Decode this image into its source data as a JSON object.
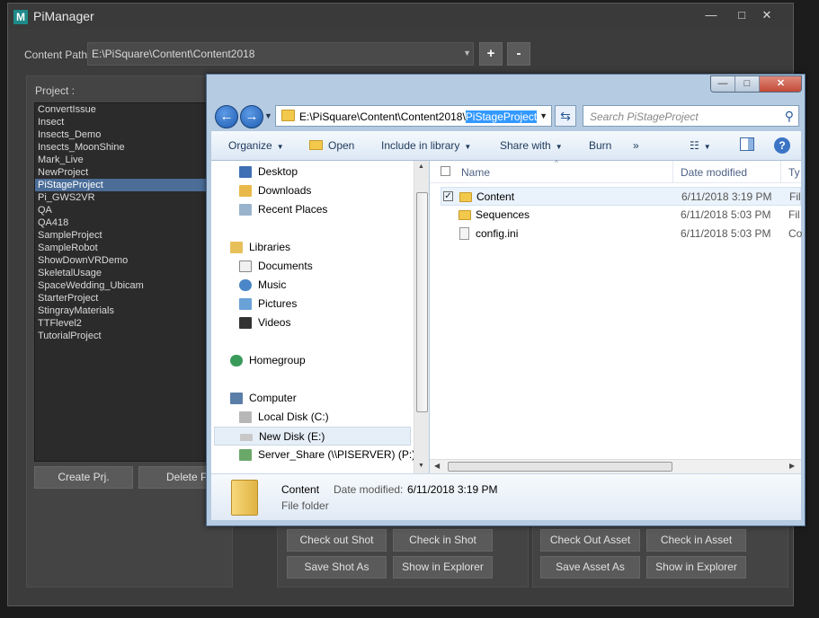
{
  "pim": {
    "title": "PiManager",
    "logo": "M",
    "window_controls": {
      "minimize": "—",
      "maximize": "□",
      "close": "✕"
    },
    "content_path_label": "Content Path:",
    "content_path_value": "E:\\PiSquare\\Content\\Content2018",
    "add_label": "+",
    "remove_label": "-",
    "project_label": "Project :",
    "projects": [
      "ConvertIssue",
      "Insect",
      "Insects_Demo",
      "Insects_MoonShine",
      "Mark_Live",
      "NewProject",
      "PiStageProject",
      "Pi_GWS2VR",
      "QA",
      "QA418",
      "SampleProject",
      "SampleRobot",
      "ShowDownVRDemo",
      "SkeletalUsage",
      "SpaceWedding_Ubicam",
      "StarterProject",
      "StingrayMaterials",
      "TTFlevel2",
      "TutorialProject"
    ],
    "selected_project": "PiStageProject",
    "create_project": "Create Prj.",
    "delete_project": "Delete Pr",
    "shot_buttons": {
      "checkout": "Check out Shot",
      "checkin": "Check in Shot",
      "saveas": "Save Shot As",
      "explorer": "Show in Explorer"
    },
    "asset_buttons": {
      "checkout": "Check Out Asset",
      "checkin": "Check in Asset",
      "saveas": "Save Asset As",
      "explorer": "Show in Explorer"
    }
  },
  "explorer": {
    "address_prefix": "E:\\PiSquare\\Content\\Content2018\\",
    "address_selected": "PiStageProject",
    "search_placeholder": "Search PiStageProject",
    "toolbar": {
      "organize": "Organize",
      "open": "Open",
      "include": "Include in library",
      "share": "Share with",
      "burn": "Burn",
      "more": "»"
    },
    "nav": {
      "desktop": "Desktop",
      "downloads": "Downloads",
      "recent": "Recent Places",
      "libraries": "Libraries",
      "documents": "Documents",
      "music": "Music",
      "pictures": "Pictures",
      "videos": "Videos",
      "homegroup": "Homegroup",
      "computer": "Computer",
      "local_disk": "Local Disk (C:)",
      "new_disk": "New Disk (E:)",
      "server_share": "Server_Share (\\\\PISERVER) (P:)"
    },
    "columns": {
      "name": "Name",
      "date": "Date modified",
      "type": "Ty"
    },
    "files": [
      {
        "name": "Content",
        "date": "6/11/2018 3:19 PM",
        "type": "Fil",
        "icon": "folder-icon"
      },
      {
        "name": "Sequences",
        "date": "6/11/2018 5:03 PM",
        "type": "Fil",
        "icon": "folder-icon"
      },
      {
        "name": "config.ini",
        "date": "6/11/2018 5:03 PM",
        "type": "Co",
        "icon": "ini-file-icon"
      }
    ],
    "details": {
      "name": "Content",
      "date_label": "Date modified:",
      "date_value": "6/11/2018 3:19 PM",
      "type": "File folder"
    },
    "window_controls": {
      "minimize": "—",
      "maximize": "□",
      "close": "✕"
    }
  }
}
